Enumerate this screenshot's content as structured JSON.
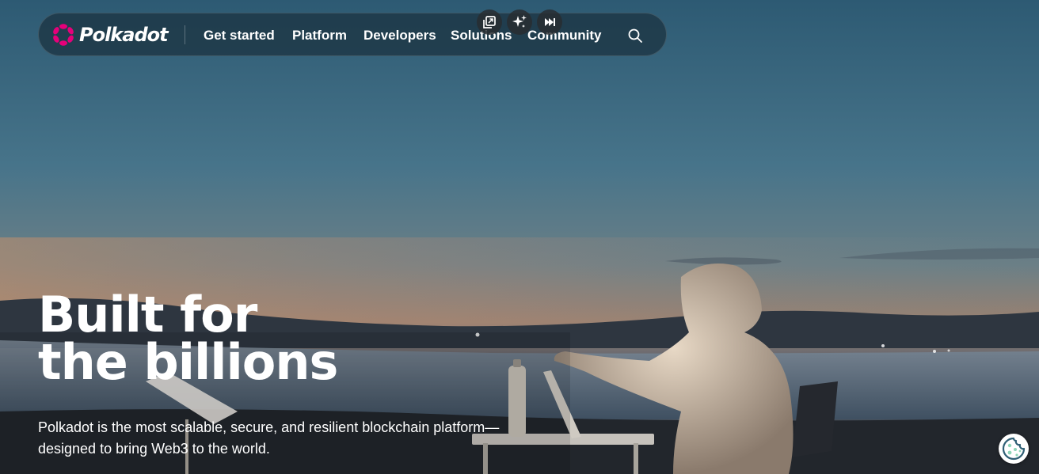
{
  "brand": {
    "name": "Polkadot",
    "logo_color": "#e6007a"
  },
  "nav": {
    "items": [
      {
        "label": "Get started"
      },
      {
        "label": "Platform"
      },
      {
        "label": "Developers"
      },
      {
        "label": "Solutions"
      },
      {
        "label": "Community"
      }
    ],
    "search_icon": "search-icon"
  },
  "player_controls": {
    "icons": [
      "picture-in-picture-icon",
      "sparkle-icon",
      "skip-forward-icon"
    ]
  },
  "hero": {
    "title_line1": "Built for",
    "title_line2": "the billions",
    "subtitle_line1": "Polkadot is the most scalable, secure, and resilient blockchain platform—",
    "subtitle_line2": "designed to bring Web3 to the world."
  },
  "cookie": {
    "icon": "cookie-icon",
    "color": "#8fd6b8"
  }
}
